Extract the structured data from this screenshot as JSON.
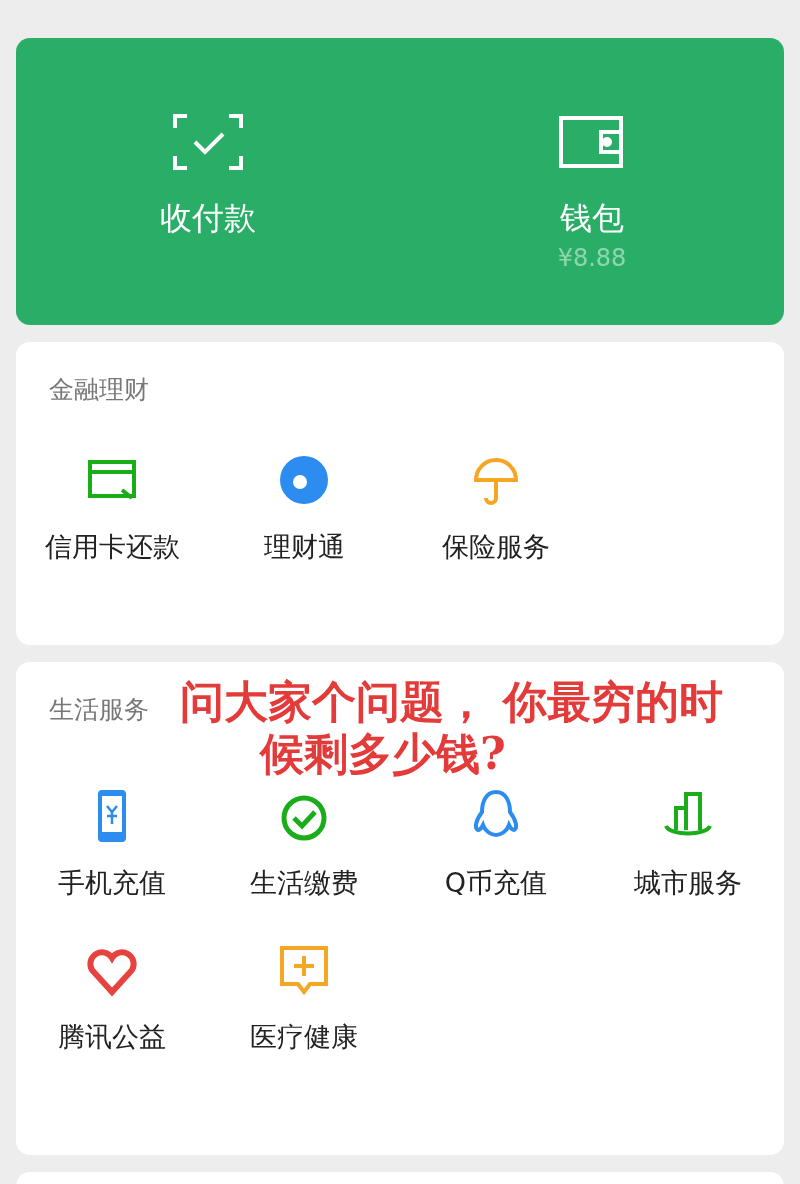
{
  "top_card": {
    "items": [
      {
        "kind": "scan",
        "label": "收付款"
      },
      {
        "kind": "wallet",
        "label": "钱包",
        "balance": "¥8.88"
      }
    ]
  },
  "sections": [
    {
      "title": "金融理财",
      "items": [
        {
          "kind": "card",
          "label": "信用卡还款"
        },
        {
          "kind": "coin",
          "label": "理财通"
        },
        {
          "kind": "umbrella",
          "label": "保险服务"
        }
      ]
    },
    {
      "title": "生活服务",
      "items": [
        {
          "kind": "phone",
          "label": "手机充值"
        },
        {
          "kind": "check",
          "label": "生活缴费"
        },
        {
          "kind": "penguin",
          "label": "Q币充值"
        },
        {
          "kind": "city",
          "label": "城市服务"
        },
        {
          "kind": "heart",
          "label": "腾讯公益"
        },
        {
          "kind": "medical",
          "label": "医疗健康"
        }
      ]
    }
  ],
  "caption": {
    "lines": [
      "问大家个问题， 你最穷的时",
      "候剩多少钱?"
    ]
  }
}
